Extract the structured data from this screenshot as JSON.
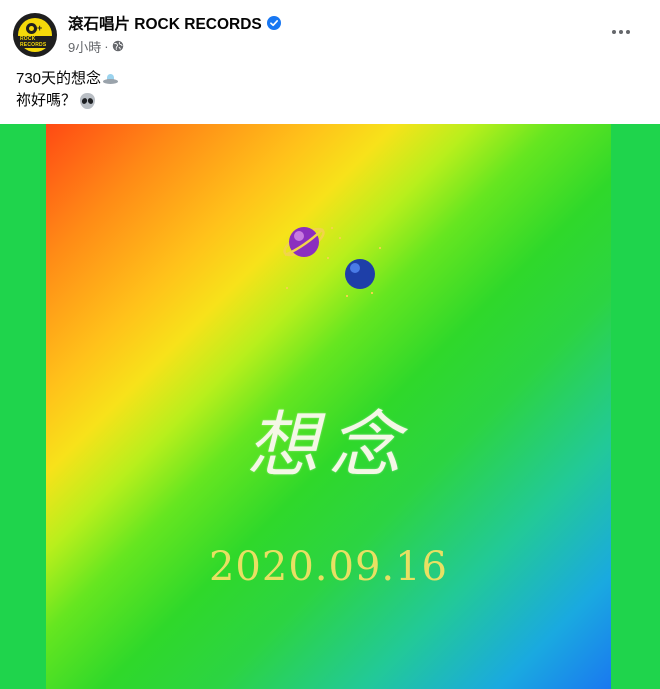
{
  "post": {
    "page_name": "滾石唱片 ROCK RECORDS",
    "avatar_text": "ROCK RECORDS",
    "timestamp": "9小時",
    "separator": "·",
    "privacy_icon": "globe-icon",
    "verified_icon": "verified-badge-icon",
    "more_icon": "more-options-icon",
    "caption_line1": "730天的想念",
    "caption_line1_emoji": "ufo-emoji",
    "caption_line2": "祢好嗎？",
    "caption_line2_emoji": "alien-emoji"
  },
  "artwork": {
    "title": "想念",
    "date": "2020.09.16",
    "icons": [
      "purple-planet-icon",
      "blue-planet-icon"
    ]
  },
  "colors": {
    "media_background": "#1fd44c",
    "verified_blue": "#1877f2",
    "date_yellow": "#e8e063",
    "title_white": "#f4f7e6"
  }
}
